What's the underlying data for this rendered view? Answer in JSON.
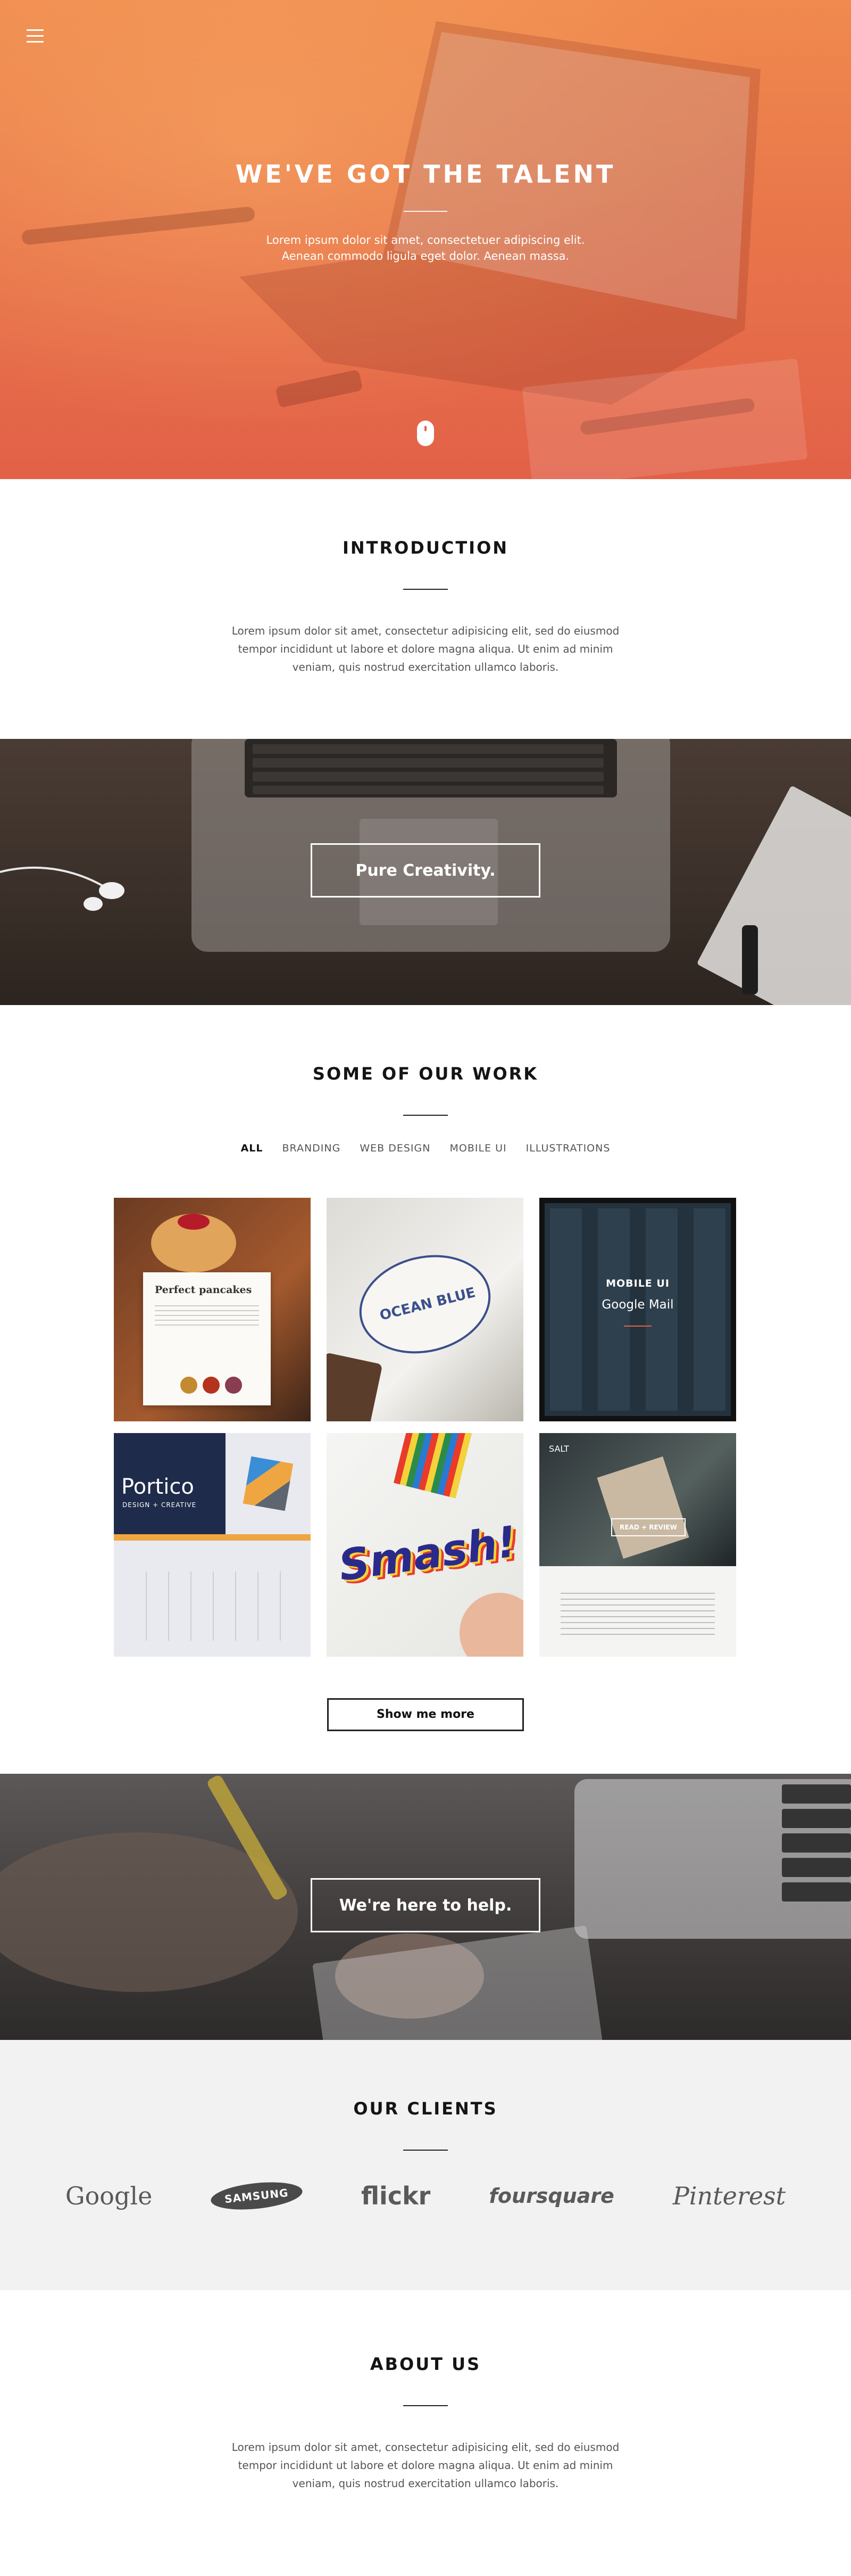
{
  "hero": {
    "menu_icon": "hamburger-menu-icon",
    "title": "WE'VE GOT THE TALENT",
    "text_line1": "Lorem ipsum dolor sit amet, consectetuer adipiscing elit.",
    "text_line2": "Aenean commodo ligula eget dolor. Aenean massa.",
    "scroll_icon": "mouse-scroll-icon"
  },
  "intro": {
    "title": "INTRODUCTION",
    "text": "Lorem ipsum dolor sit amet, consectetur adipisicing elit, sed do eiusmod tempor incididunt ut labore et dolore magna aliqua. Ut enim ad minim veniam, quis nostrud exercitation ullamco laboris."
  },
  "band1": {
    "button": "Pure Creativity."
  },
  "work": {
    "title": "SOME OF OUR WORK",
    "filters": [
      "ALL",
      "BRANDING",
      "WEB DESIGN",
      "MOBILE UI",
      "ILLUSTRATIONS"
    ],
    "tile1": {
      "heading": "Perfect pancakes"
    },
    "tile2": {
      "badge": "OCEAN BLUE"
    },
    "tile3": {
      "category": "MOBILE UI",
      "title": "Google Mail"
    },
    "tile4": {
      "brand": "Portico",
      "sub": "DESIGN + CREATIVE"
    },
    "tile5": {
      "word": "Smash!"
    },
    "tile6": {
      "label": "SALT",
      "button": "READ + REVIEW"
    },
    "show_more": "Show me more"
  },
  "band2": {
    "button": "We're here to help."
  },
  "clients": {
    "title": "OUR CLIENTS",
    "logos": [
      "Google",
      "SAMSUNG",
      "flickr",
      "foursquare",
      "Pinterest"
    ]
  },
  "about": {
    "title": "ABOUT US",
    "text": "Lorem ipsum dolor sit amet, consectetur adipisicing elit, sed do eiusmod tempor incididunt ut labore et dolore magna aliqua. Ut enim ad minim veniam, quis nostrud exercitation ullamco laboris."
  },
  "colors": {
    "accent": "#e26148",
    "hero_top": "#f08a4e",
    "dark": "#141414"
  }
}
